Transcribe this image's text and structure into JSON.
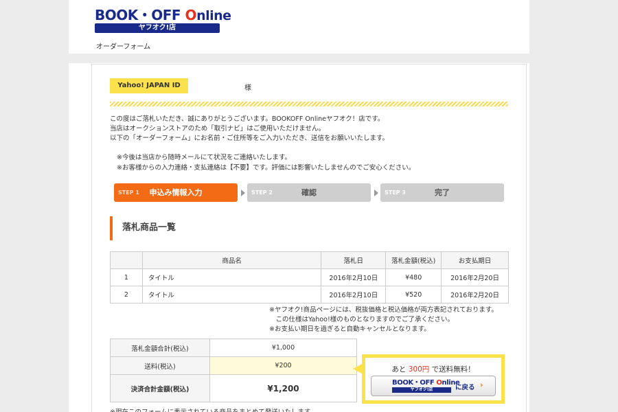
{
  "header": {
    "logo_text_book": "BOOK",
    "logo_text_dot": "・",
    "logo_text_off": "OFF ",
    "logo_text_online": "nline",
    "logo_power_glyph": "O",
    "logo_subtitle": "ヤフオク!店",
    "page_label": "オーダーフォーム"
  },
  "account": {
    "id_label": "Yahoo! JAPAN ID",
    "honorific": "様"
  },
  "intro": [
    "この度はご落札いただき、誠にありがとうございます。BOOKOFF Onlineヤフオク！店です。",
    "当店はオークションストアのため「取引ナビ」はご使用いただけません。",
    "以下の「オーダーフォーム」にお名前・ご住所等をご入力いただき、送信をお願いいたします。"
  ],
  "notes": [
    "※今後は当店から随時メールにて状況をご連絡いたします。",
    "※お客様からの入力連絡・支払連絡は【不要】です。評価には影響いたしませんのでご安心ください。"
  ],
  "steps": [
    {
      "num": "STEP 1",
      "name": "申込み情報入力",
      "active": true
    },
    {
      "num": "STEP 2",
      "name": "確認",
      "active": false
    },
    {
      "num": "STEP 3",
      "name": "完了",
      "active": false
    }
  ],
  "section_title": "落札商品一覧",
  "items_table": {
    "headers": [
      "",
      "商品名",
      "落札日",
      "落札金額(税込)",
      "お支払期日"
    ],
    "rows": [
      [
        "1",
        "タイトル",
        "2016年2月10日",
        "¥480",
        "2016年2月20日"
      ],
      [
        "2",
        "タイトル",
        "2016年2月10日",
        "¥520",
        "2016年2月20日"
      ]
    ]
  },
  "fine_print": [
    "※ヤフオク!商品ページには、税抜価格と税込価格が両方表記されております。",
    "　この仕様はYahoo!様のものとなりますのでご了承ください。",
    "※お支払い期日を過ぎると自動キャンセルとなります。"
  ],
  "totals": {
    "subtotal_label": "落札金額合計(税込)",
    "subtotal_value": "¥1,000",
    "shipping_label": "送料(税込)",
    "shipping_value": "¥200",
    "total_label": "決済合計金額(税込)",
    "total_value": "¥1,200"
  },
  "promo": {
    "prefix": "あと ",
    "amount": "300円",
    "suffix": " で送料無料！",
    "button_logo_top_book": "BOOK・OFF ",
    "button_logo_top_power": "O",
    "button_logo_top_online": "nline",
    "button_logo_sub": "ヤフオク!店",
    "button_label": "に戻る",
    "button_chevron": "›"
  },
  "footnote": "※現在このフォームに表示されている商品をまとめて発送いたします。",
  "colors": {
    "accent_orange": "#f36c15",
    "brand_navy": "#1a2a8a",
    "highlight_yellow": "#fbe14b",
    "price_red": "#e8301c"
  }
}
